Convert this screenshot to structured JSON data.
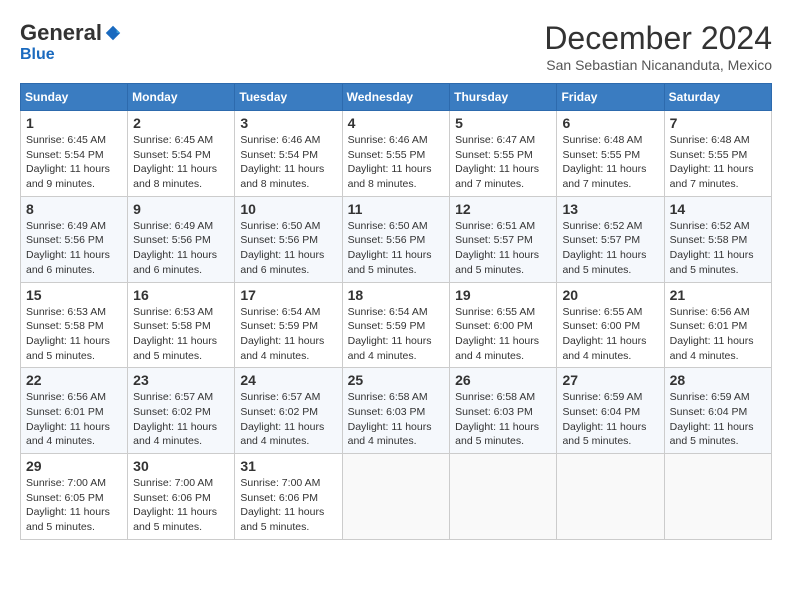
{
  "logo": {
    "general": "General",
    "blue": "Blue"
  },
  "title": "December 2024",
  "location": "San Sebastian Nicananduta, Mexico",
  "weekdays": [
    "Sunday",
    "Monday",
    "Tuesday",
    "Wednesday",
    "Thursday",
    "Friday",
    "Saturday"
  ],
  "weeks": [
    [
      {
        "day": "1",
        "sunrise": "Sunrise: 6:45 AM",
        "sunset": "Sunset: 5:54 PM",
        "daylight": "Daylight: 11 hours and 9 minutes."
      },
      {
        "day": "2",
        "sunrise": "Sunrise: 6:45 AM",
        "sunset": "Sunset: 5:54 PM",
        "daylight": "Daylight: 11 hours and 8 minutes."
      },
      {
        "day": "3",
        "sunrise": "Sunrise: 6:46 AM",
        "sunset": "Sunset: 5:54 PM",
        "daylight": "Daylight: 11 hours and 8 minutes."
      },
      {
        "day": "4",
        "sunrise": "Sunrise: 6:46 AM",
        "sunset": "Sunset: 5:55 PM",
        "daylight": "Daylight: 11 hours and 8 minutes."
      },
      {
        "day": "5",
        "sunrise": "Sunrise: 6:47 AM",
        "sunset": "Sunset: 5:55 PM",
        "daylight": "Daylight: 11 hours and 7 minutes."
      },
      {
        "day": "6",
        "sunrise": "Sunrise: 6:48 AM",
        "sunset": "Sunset: 5:55 PM",
        "daylight": "Daylight: 11 hours and 7 minutes."
      },
      {
        "day": "7",
        "sunrise": "Sunrise: 6:48 AM",
        "sunset": "Sunset: 5:55 PM",
        "daylight": "Daylight: 11 hours and 7 minutes."
      }
    ],
    [
      {
        "day": "8",
        "sunrise": "Sunrise: 6:49 AM",
        "sunset": "Sunset: 5:56 PM",
        "daylight": "Daylight: 11 hours and 6 minutes."
      },
      {
        "day": "9",
        "sunrise": "Sunrise: 6:49 AM",
        "sunset": "Sunset: 5:56 PM",
        "daylight": "Daylight: 11 hours and 6 minutes."
      },
      {
        "day": "10",
        "sunrise": "Sunrise: 6:50 AM",
        "sunset": "Sunset: 5:56 PM",
        "daylight": "Daylight: 11 hours and 6 minutes."
      },
      {
        "day": "11",
        "sunrise": "Sunrise: 6:50 AM",
        "sunset": "Sunset: 5:56 PM",
        "daylight": "Daylight: 11 hours and 5 minutes."
      },
      {
        "day": "12",
        "sunrise": "Sunrise: 6:51 AM",
        "sunset": "Sunset: 5:57 PM",
        "daylight": "Daylight: 11 hours and 5 minutes."
      },
      {
        "day": "13",
        "sunrise": "Sunrise: 6:52 AM",
        "sunset": "Sunset: 5:57 PM",
        "daylight": "Daylight: 11 hours and 5 minutes."
      },
      {
        "day": "14",
        "sunrise": "Sunrise: 6:52 AM",
        "sunset": "Sunset: 5:58 PM",
        "daylight": "Daylight: 11 hours and 5 minutes."
      }
    ],
    [
      {
        "day": "15",
        "sunrise": "Sunrise: 6:53 AM",
        "sunset": "Sunset: 5:58 PM",
        "daylight": "Daylight: 11 hours and 5 minutes."
      },
      {
        "day": "16",
        "sunrise": "Sunrise: 6:53 AM",
        "sunset": "Sunset: 5:58 PM",
        "daylight": "Daylight: 11 hours and 5 minutes."
      },
      {
        "day": "17",
        "sunrise": "Sunrise: 6:54 AM",
        "sunset": "Sunset: 5:59 PM",
        "daylight": "Daylight: 11 hours and 4 minutes."
      },
      {
        "day": "18",
        "sunrise": "Sunrise: 6:54 AM",
        "sunset": "Sunset: 5:59 PM",
        "daylight": "Daylight: 11 hours and 4 minutes."
      },
      {
        "day": "19",
        "sunrise": "Sunrise: 6:55 AM",
        "sunset": "Sunset: 6:00 PM",
        "daylight": "Daylight: 11 hours and 4 minutes."
      },
      {
        "day": "20",
        "sunrise": "Sunrise: 6:55 AM",
        "sunset": "Sunset: 6:00 PM",
        "daylight": "Daylight: 11 hours and 4 minutes."
      },
      {
        "day": "21",
        "sunrise": "Sunrise: 6:56 AM",
        "sunset": "Sunset: 6:01 PM",
        "daylight": "Daylight: 11 hours and 4 minutes."
      }
    ],
    [
      {
        "day": "22",
        "sunrise": "Sunrise: 6:56 AM",
        "sunset": "Sunset: 6:01 PM",
        "daylight": "Daylight: 11 hours and 4 minutes."
      },
      {
        "day": "23",
        "sunrise": "Sunrise: 6:57 AM",
        "sunset": "Sunset: 6:02 PM",
        "daylight": "Daylight: 11 hours and 4 minutes."
      },
      {
        "day": "24",
        "sunrise": "Sunrise: 6:57 AM",
        "sunset": "Sunset: 6:02 PM",
        "daylight": "Daylight: 11 hours and 4 minutes."
      },
      {
        "day": "25",
        "sunrise": "Sunrise: 6:58 AM",
        "sunset": "Sunset: 6:03 PM",
        "daylight": "Daylight: 11 hours and 4 minutes."
      },
      {
        "day": "26",
        "sunrise": "Sunrise: 6:58 AM",
        "sunset": "Sunset: 6:03 PM",
        "daylight": "Daylight: 11 hours and 5 minutes."
      },
      {
        "day": "27",
        "sunrise": "Sunrise: 6:59 AM",
        "sunset": "Sunset: 6:04 PM",
        "daylight": "Daylight: 11 hours and 5 minutes."
      },
      {
        "day": "28",
        "sunrise": "Sunrise: 6:59 AM",
        "sunset": "Sunset: 6:04 PM",
        "daylight": "Daylight: 11 hours and 5 minutes."
      }
    ],
    [
      {
        "day": "29",
        "sunrise": "Sunrise: 7:00 AM",
        "sunset": "Sunset: 6:05 PM",
        "daylight": "Daylight: 11 hours and 5 minutes."
      },
      {
        "day": "30",
        "sunrise": "Sunrise: 7:00 AM",
        "sunset": "Sunset: 6:06 PM",
        "daylight": "Daylight: 11 hours and 5 minutes."
      },
      {
        "day": "31",
        "sunrise": "Sunrise: 7:00 AM",
        "sunset": "Sunset: 6:06 PM",
        "daylight": "Daylight: 11 hours and 5 minutes."
      },
      null,
      null,
      null,
      null
    ]
  ]
}
